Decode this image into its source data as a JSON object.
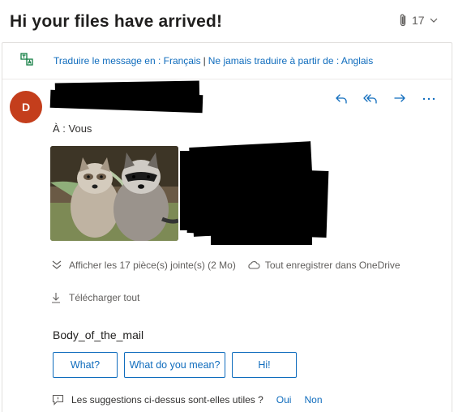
{
  "header": {
    "title": "Hi your files have arrived!",
    "attachment_count": "17"
  },
  "translation": {
    "translate_link": "Traduire le message en : Français",
    "separator": "|",
    "never_translate_link": "Ne jamais traduire à partir de : Anglais"
  },
  "message": {
    "avatar_initial": "D",
    "to_line": "À :  Vous",
    "actions": [
      "reply-icon",
      "reply-all-icon",
      "forward-icon",
      "more-icon"
    ],
    "body": "Body_of_the_mail"
  },
  "attachments": {
    "show_all": "Afficher les 17 pièce(s) jointe(s) (2 Mo)",
    "save_onedrive": "Tout enregistrer dans OneDrive",
    "download_all": "Télécharger tout"
  },
  "suggested_replies": [
    "What?",
    "What do you mean?",
    "Hi!"
  ],
  "feedback": {
    "question": "Les suggestions ci-dessus sont-elles utiles ?",
    "yes": "Oui",
    "no": "Non"
  },
  "colors": {
    "accent": "#0f6cbd",
    "avatar": "#c43e1c"
  }
}
